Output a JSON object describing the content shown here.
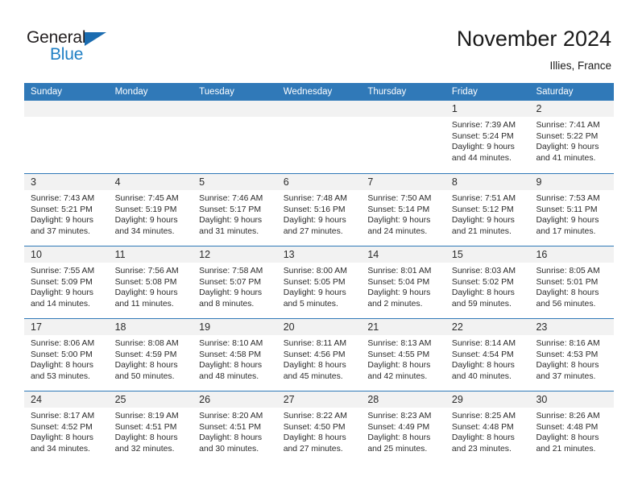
{
  "brand": {
    "name_part1": "General",
    "name_part2": "Blue",
    "triangle_color": "#1b6cb0",
    "blue_color": "#1f7fc4"
  },
  "header": {
    "title": "November 2024",
    "subtitle": "Illies, France"
  },
  "theme": {
    "header_band": "#3079b8",
    "daynum_bar": "#f2f2f2",
    "grid_line": "#3079b8",
    "text": "#2b2b2b"
  },
  "calendar": {
    "weekday_headers": [
      "Sunday",
      "Monday",
      "Tuesday",
      "Wednesday",
      "Thursday",
      "Friday",
      "Saturday"
    ],
    "weeks": [
      [
        {
          "day": "",
          "lines": []
        },
        {
          "day": "",
          "lines": []
        },
        {
          "day": "",
          "lines": []
        },
        {
          "day": "",
          "lines": []
        },
        {
          "day": "",
          "lines": []
        },
        {
          "day": "1",
          "lines": [
            "Sunrise: 7:39 AM",
            "Sunset: 5:24 PM",
            "Daylight: 9 hours",
            "and 44 minutes."
          ]
        },
        {
          "day": "2",
          "lines": [
            "Sunrise: 7:41 AM",
            "Sunset: 5:22 PM",
            "Daylight: 9 hours",
            "and 41 minutes."
          ]
        }
      ],
      [
        {
          "day": "3",
          "lines": [
            "Sunrise: 7:43 AM",
            "Sunset: 5:21 PM",
            "Daylight: 9 hours",
            "and 37 minutes."
          ]
        },
        {
          "day": "4",
          "lines": [
            "Sunrise: 7:45 AM",
            "Sunset: 5:19 PM",
            "Daylight: 9 hours",
            "and 34 minutes."
          ]
        },
        {
          "day": "5",
          "lines": [
            "Sunrise: 7:46 AM",
            "Sunset: 5:17 PM",
            "Daylight: 9 hours",
            "and 31 minutes."
          ]
        },
        {
          "day": "6",
          "lines": [
            "Sunrise: 7:48 AM",
            "Sunset: 5:16 PM",
            "Daylight: 9 hours",
            "and 27 minutes."
          ]
        },
        {
          "day": "7",
          "lines": [
            "Sunrise: 7:50 AM",
            "Sunset: 5:14 PM",
            "Daylight: 9 hours",
            "and 24 minutes."
          ]
        },
        {
          "day": "8",
          "lines": [
            "Sunrise: 7:51 AM",
            "Sunset: 5:12 PM",
            "Daylight: 9 hours",
            "and 21 minutes."
          ]
        },
        {
          "day": "9",
          "lines": [
            "Sunrise: 7:53 AM",
            "Sunset: 5:11 PM",
            "Daylight: 9 hours",
            "and 17 minutes."
          ]
        }
      ],
      [
        {
          "day": "10",
          "lines": [
            "Sunrise: 7:55 AM",
            "Sunset: 5:09 PM",
            "Daylight: 9 hours",
            "and 14 minutes."
          ]
        },
        {
          "day": "11",
          "lines": [
            "Sunrise: 7:56 AM",
            "Sunset: 5:08 PM",
            "Daylight: 9 hours",
            "and 11 minutes."
          ]
        },
        {
          "day": "12",
          "lines": [
            "Sunrise: 7:58 AM",
            "Sunset: 5:07 PM",
            "Daylight: 9 hours",
            "and 8 minutes."
          ]
        },
        {
          "day": "13",
          "lines": [
            "Sunrise: 8:00 AM",
            "Sunset: 5:05 PM",
            "Daylight: 9 hours",
            "and 5 minutes."
          ]
        },
        {
          "day": "14",
          "lines": [
            "Sunrise: 8:01 AM",
            "Sunset: 5:04 PM",
            "Daylight: 9 hours",
            "and 2 minutes."
          ]
        },
        {
          "day": "15",
          "lines": [
            "Sunrise: 8:03 AM",
            "Sunset: 5:02 PM",
            "Daylight: 8 hours",
            "and 59 minutes."
          ]
        },
        {
          "day": "16",
          "lines": [
            "Sunrise: 8:05 AM",
            "Sunset: 5:01 PM",
            "Daylight: 8 hours",
            "and 56 minutes."
          ]
        }
      ],
      [
        {
          "day": "17",
          "lines": [
            "Sunrise: 8:06 AM",
            "Sunset: 5:00 PM",
            "Daylight: 8 hours",
            "and 53 minutes."
          ]
        },
        {
          "day": "18",
          "lines": [
            "Sunrise: 8:08 AM",
            "Sunset: 4:59 PM",
            "Daylight: 8 hours",
            "and 50 minutes."
          ]
        },
        {
          "day": "19",
          "lines": [
            "Sunrise: 8:10 AM",
            "Sunset: 4:58 PM",
            "Daylight: 8 hours",
            "and 48 minutes."
          ]
        },
        {
          "day": "20",
          "lines": [
            "Sunrise: 8:11 AM",
            "Sunset: 4:56 PM",
            "Daylight: 8 hours",
            "and 45 minutes."
          ]
        },
        {
          "day": "21",
          "lines": [
            "Sunrise: 8:13 AM",
            "Sunset: 4:55 PM",
            "Daylight: 8 hours",
            "and 42 minutes."
          ]
        },
        {
          "day": "22",
          "lines": [
            "Sunrise: 8:14 AM",
            "Sunset: 4:54 PM",
            "Daylight: 8 hours",
            "and 40 minutes."
          ]
        },
        {
          "day": "23",
          "lines": [
            "Sunrise: 8:16 AM",
            "Sunset: 4:53 PM",
            "Daylight: 8 hours",
            "and 37 minutes."
          ]
        }
      ],
      [
        {
          "day": "24",
          "lines": [
            "Sunrise: 8:17 AM",
            "Sunset: 4:52 PM",
            "Daylight: 8 hours",
            "and 34 minutes."
          ]
        },
        {
          "day": "25",
          "lines": [
            "Sunrise: 8:19 AM",
            "Sunset: 4:51 PM",
            "Daylight: 8 hours",
            "and 32 minutes."
          ]
        },
        {
          "day": "26",
          "lines": [
            "Sunrise: 8:20 AM",
            "Sunset: 4:51 PM",
            "Daylight: 8 hours",
            "and 30 minutes."
          ]
        },
        {
          "day": "27",
          "lines": [
            "Sunrise: 8:22 AM",
            "Sunset: 4:50 PM",
            "Daylight: 8 hours",
            "and 27 minutes."
          ]
        },
        {
          "day": "28",
          "lines": [
            "Sunrise: 8:23 AM",
            "Sunset: 4:49 PM",
            "Daylight: 8 hours",
            "and 25 minutes."
          ]
        },
        {
          "day": "29",
          "lines": [
            "Sunrise: 8:25 AM",
            "Sunset: 4:48 PM",
            "Daylight: 8 hours",
            "and 23 minutes."
          ]
        },
        {
          "day": "30",
          "lines": [
            "Sunrise: 8:26 AM",
            "Sunset: 4:48 PM",
            "Daylight: 8 hours",
            "and 21 minutes."
          ]
        }
      ]
    ]
  }
}
